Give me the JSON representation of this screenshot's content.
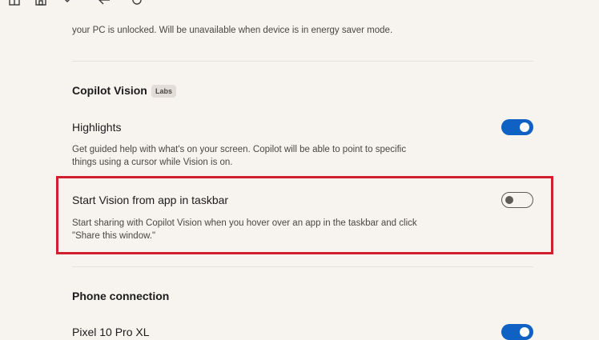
{
  "toolbar": {
    "icons": [
      "window-icon",
      "home-icon",
      "chevron-down-icon",
      "back-arrow-icon",
      "refresh-icon"
    ]
  },
  "top_fragment": {
    "desc": "your PC is unlocked. Will be unavailable when device is in energy saver mode."
  },
  "copilot_vision": {
    "title": "Copilot Vision",
    "badge": "Labs",
    "settings": [
      {
        "label": "Highlights",
        "desc": "Get guided help with what's on your screen. Copilot will be able to point to specific things using a cursor while Vision is on.",
        "enabled": true
      },
      {
        "label": "Start Vision from app in taskbar",
        "desc": "Start sharing with Copilot Vision when you hover over an app in the taskbar and click \"Share this window.\"",
        "enabled": false
      }
    ]
  },
  "phone_connection": {
    "title": "Phone connection",
    "settings": [
      {
        "label": "Pixel 10 Pro XL",
        "enabled": true
      }
    ]
  },
  "colors": {
    "background": "#f7f3ef",
    "toggle_on": "#0f62c4",
    "highlight": "#d0202e"
  }
}
